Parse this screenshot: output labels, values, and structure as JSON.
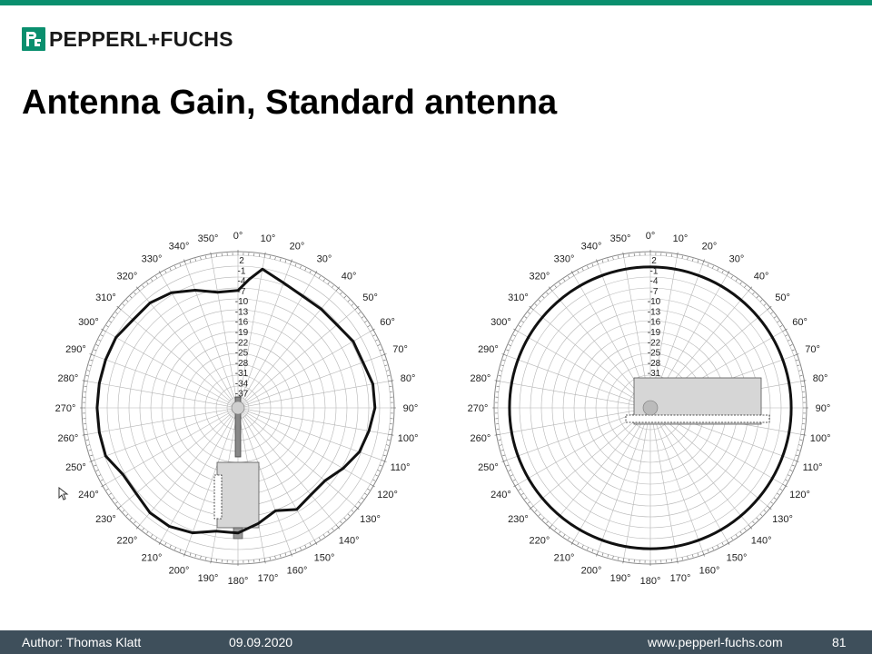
{
  "brand": {
    "name": "PEPPERL+FUCHS",
    "color": "#0a8f6e"
  },
  "slide": {
    "title": "Antenna Gain, Standard antenna"
  },
  "footer": {
    "author": "Author: Thomas Klatt",
    "date": "09.09.2020",
    "url": "www.pepperl-fuchs.com",
    "page": "81",
    "bg": "#3e4f5b"
  },
  "chart_data": [
    {
      "type": "polar",
      "angles_deg": [
        0,
        10,
        20,
        30,
        40,
        50,
        60,
        70,
        80,
        90,
        100,
        110,
        120,
        130,
        140,
        150,
        160,
        170,
        180,
        190,
        200,
        210,
        220,
        230,
        240,
        250,
        260,
        270,
        280,
        290,
        300,
        310,
        320,
        330,
        340,
        350
      ],
      "radial_ticks": [
        "2",
        "-1",
        "-4",
        "-7",
        "-10",
        "-13",
        "-16",
        "-19",
        "-22",
        "-25",
        "-28",
        "-31",
        "-34",
        "-37"
      ],
      "series": [
        {
          "angles_deg": [
            0,
            5,
            10,
            20,
            30,
            40,
            50,
            60,
            70,
            80,
            90,
            100,
            110,
            120,
            130,
            140,
            150,
            160,
            170,
            180,
            190,
            200,
            210,
            220,
            230,
            240,
            250,
            260,
            270,
            280,
            290,
            300,
            310,
            320,
            330,
            340,
            350
          ],
          "values": [
            -7,
            -4,
            -1,
            -3,
            -4,
            -4,
            -4,
            -3,
            -3,
            -2,
            -2,
            -3,
            -4,
            -6,
            -8,
            -8,
            -7,
            -9,
            -7,
            -5,
            -5,
            -3,
            -2,
            -2,
            -3,
            -3,
            -1,
            -1,
            -1,
            -1,
            -1,
            -1,
            -2,
            -2,
            -3,
            -5,
            -7
          ]
        }
      ]
    },
    {
      "type": "polar",
      "angles_deg": [
        0,
        10,
        20,
        30,
        40,
        50,
        60,
        70,
        80,
        90,
        100,
        110,
        120,
        130,
        140,
        150,
        160,
        170,
        180,
        190,
        200,
        210,
        220,
        230,
        240,
        250,
        260,
        270,
        280,
        290,
        300,
        310,
        320,
        330,
        340,
        350
      ],
      "radial_ticks": [
        "2",
        "-1",
        "-4",
        "-7",
        "-10",
        "-13",
        "-16",
        "-19",
        "-22",
        "-25",
        "-28",
        "-31",
        "-34",
        "-37"
      ],
      "series": [
        {
          "angles_deg": [
            0,
            90,
            180,
            270
          ],
          "values": [
            -1,
            -1,
            -1,
            -1
          ]
        }
      ]
    }
  ]
}
